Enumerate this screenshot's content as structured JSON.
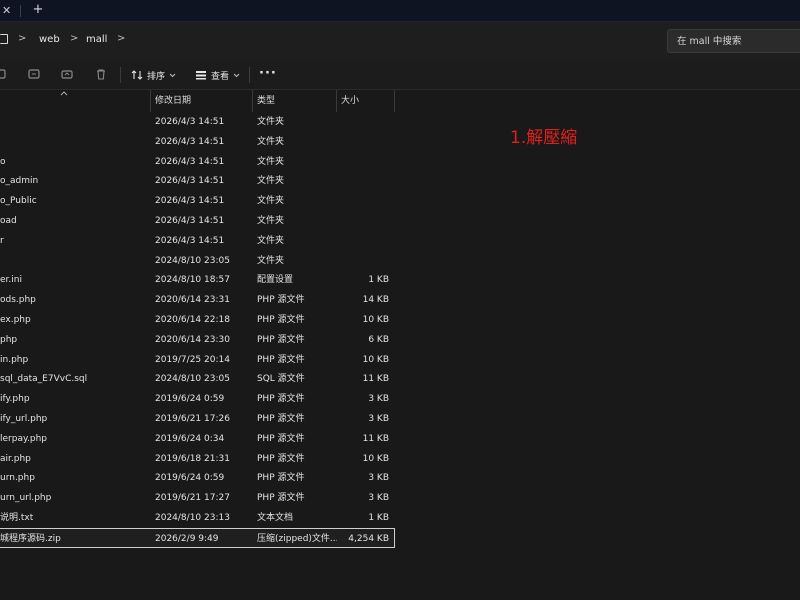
{
  "tabs": {
    "close_glyph": "✕",
    "new_glyph": "+"
  },
  "breadcrumb": {
    "items": [
      "web",
      "mall"
    ],
    "separator": ">"
  },
  "search": {
    "placeholder": "在 mall 中搜索"
  },
  "toolbar": {
    "sort_label": "排序",
    "view_label": "查看",
    "more_glyph": "···"
  },
  "columns": {
    "date": "修改日期",
    "type": "类型",
    "size": "大小"
  },
  "files": [
    {
      "name": "",
      "date": "2026/4/3 14:51",
      "type": "文件夹",
      "size": ""
    },
    {
      "name": "",
      "date": "2026/4/3 14:51",
      "type": "文件夹",
      "size": ""
    },
    {
      "name": "o",
      "date": "2026/4/3 14:51",
      "type": "文件夹",
      "size": ""
    },
    {
      "name": "o_admin",
      "date": "2026/4/3 14:51",
      "type": "文件夹",
      "size": ""
    },
    {
      "name": "o_Public",
      "date": "2026/4/3 14:51",
      "type": "文件夹",
      "size": ""
    },
    {
      "name": "oad",
      "date": "2026/4/3 14:51",
      "type": "文件夹",
      "size": ""
    },
    {
      "name": "r",
      "date": "2026/4/3 14:51",
      "type": "文件夹",
      "size": ""
    },
    {
      "name": "",
      "date": "2024/8/10 23:05",
      "type": "文件夹",
      "size": ""
    },
    {
      "name": "er.ini",
      "date": "2024/8/10 18:57",
      "type": "配置设置",
      "size": "1 KB"
    },
    {
      "name": "ods.php",
      "date": "2020/6/14 23:31",
      "type": "PHP 源文件",
      "size": "14 KB"
    },
    {
      "name": "ex.php",
      "date": "2020/6/14 22:18",
      "type": "PHP 源文件",
      "size": "10 KB"
    },
    {
      "name": "php",
      "date": "2020/6/14 23:30",
      "type": "PHP 源文件",
      "size": "6 KB"
    },
    {
      "name": "in.php",
      "date": "2019/7/25 20:14",
      "type": "PHP 源文件",
      "size": "10 KB"
    },
    {
      "name": "sql_data_E7VvC.sql",
      "date": "2024/8/10 23:05",
      "type": "SQL 源文件",
      "size": "11 KB"
    },
    {
      "name": "ify.php",
      "date": "2019/6/24 0:59",
      "type": "PHP 源文件",
      "size": "3 KB"
    },
    {
      "name": "ify_url.php",
      "date": "2019/6/21 17:26",
      "type": "PHP 源文件",
      "size": "3 KB"
    },
    {
      "name": "lerpay.php",
      "date": "2019/6/24 0:34",
      "type": "PHP 源文件",
      "size": "11 KB"
    },
    {
      "name": "air.php",
      "date": "2019/6/18 21:31",
      "type": "PHP 源文件",
      "size": "10 KB"
    },
    {
      "name": "urn.php",
      "date": "2019/6/24 0:59",
      "type": "PHP 源文件",
      "size": "3 KB"
    },
    {
      "name": "urn_url.php",
      "date": "2019/6/21 17:27",
      "type": "PHP 源文件",
      "size": "3 KB"
    },
    {
      "name": "说明.txt",
      "date": "2024/8/10 23:13",
      "type": "文本文档",
      "size": "1 KB"
    },
    {
      "name": "城程序源码.zip",
      "date": "2026/2/9 9:49",
      "type": "压缩(zipped)文件...",
      "size": "4,254 KB",
      "selected": true
    }
  ],
  "annotation": "1.解壓縮",
  "colors": {
    "annotation": "#e0201c",
    "background": "#191919",
    "tabstrip": "#0f1423"
  }
}
